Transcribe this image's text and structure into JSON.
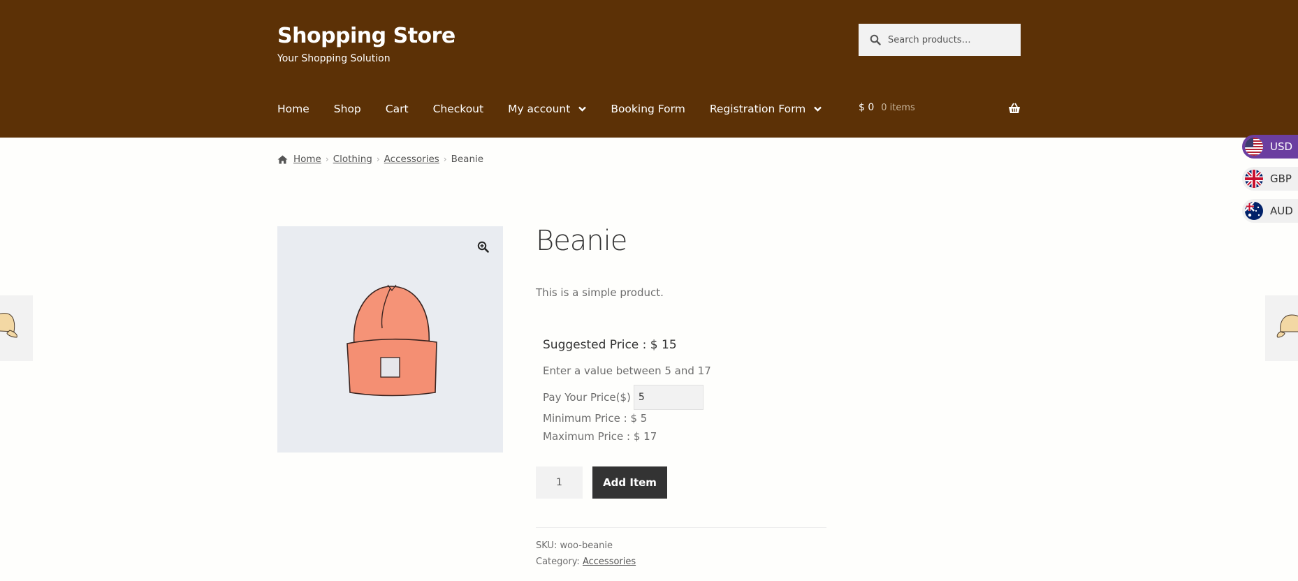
{
  "header": {
    "site_title": "Shopping Store",
    "tagline": "Your Shopping Solution",
    "search_placeholder": "Search products…",
    "bg_color": "#5c3106"
  },
  "nav": {
    "items": [
      {
        "label": "Home"
      },
      {
        "label": "Shop"
      },
      {
        "label": "Cart"
      },
      {
        "label": "Checkout"
      },
      {
        "label": "My account",
        "has_dropdown": true
      },
      {
        "label": "Booking Form"
      },
      {
        "label": "Registration Form",
        "has_dropdown": true
      }
    ]
  },
  "cart": {
    "amount": "$ 0",
    "items": "0 items"
  },
  "breadcrumb": {
    "home": "Home",
    "clothing": "Clothing",
    "accessories": "Accessories",
    "separator": "›",
    "current": "Beanie"
  },
  "product": {
    "title": "Beanie",
    "short_description": "This is a simple product.",
    "suggested_price": "Suggested Price : $ 15",
    "range_note": "Enter a value between 5 and 17",
    "pay_label": "Pay Your Price($)",
    "pay_value": "5",
    "min_price": "Minimum Price : $ 5",
    "max_price": "Maximum Price : $ 17",
    "quantity": "1",
    "add_button": "Add Item",
    "sku_label": "SKU:",
    "sku": "woo-beanie",
    "category_label": "Category:",
    "category": "Accessories"
  },
  "currency": {
    "options": [
      "USD",
      "GBP",
      "AUD"
    ],
    "selected": "USD",
    "accent": "#6b3ea0"
  },
  "icons": {
    "search": "search-icon",
    "basket": "basket-icon",
    "home": "home-icon",
    "zoom": "zoom-icon",
    "chevron": "chevron-down-icon"
  }
}
